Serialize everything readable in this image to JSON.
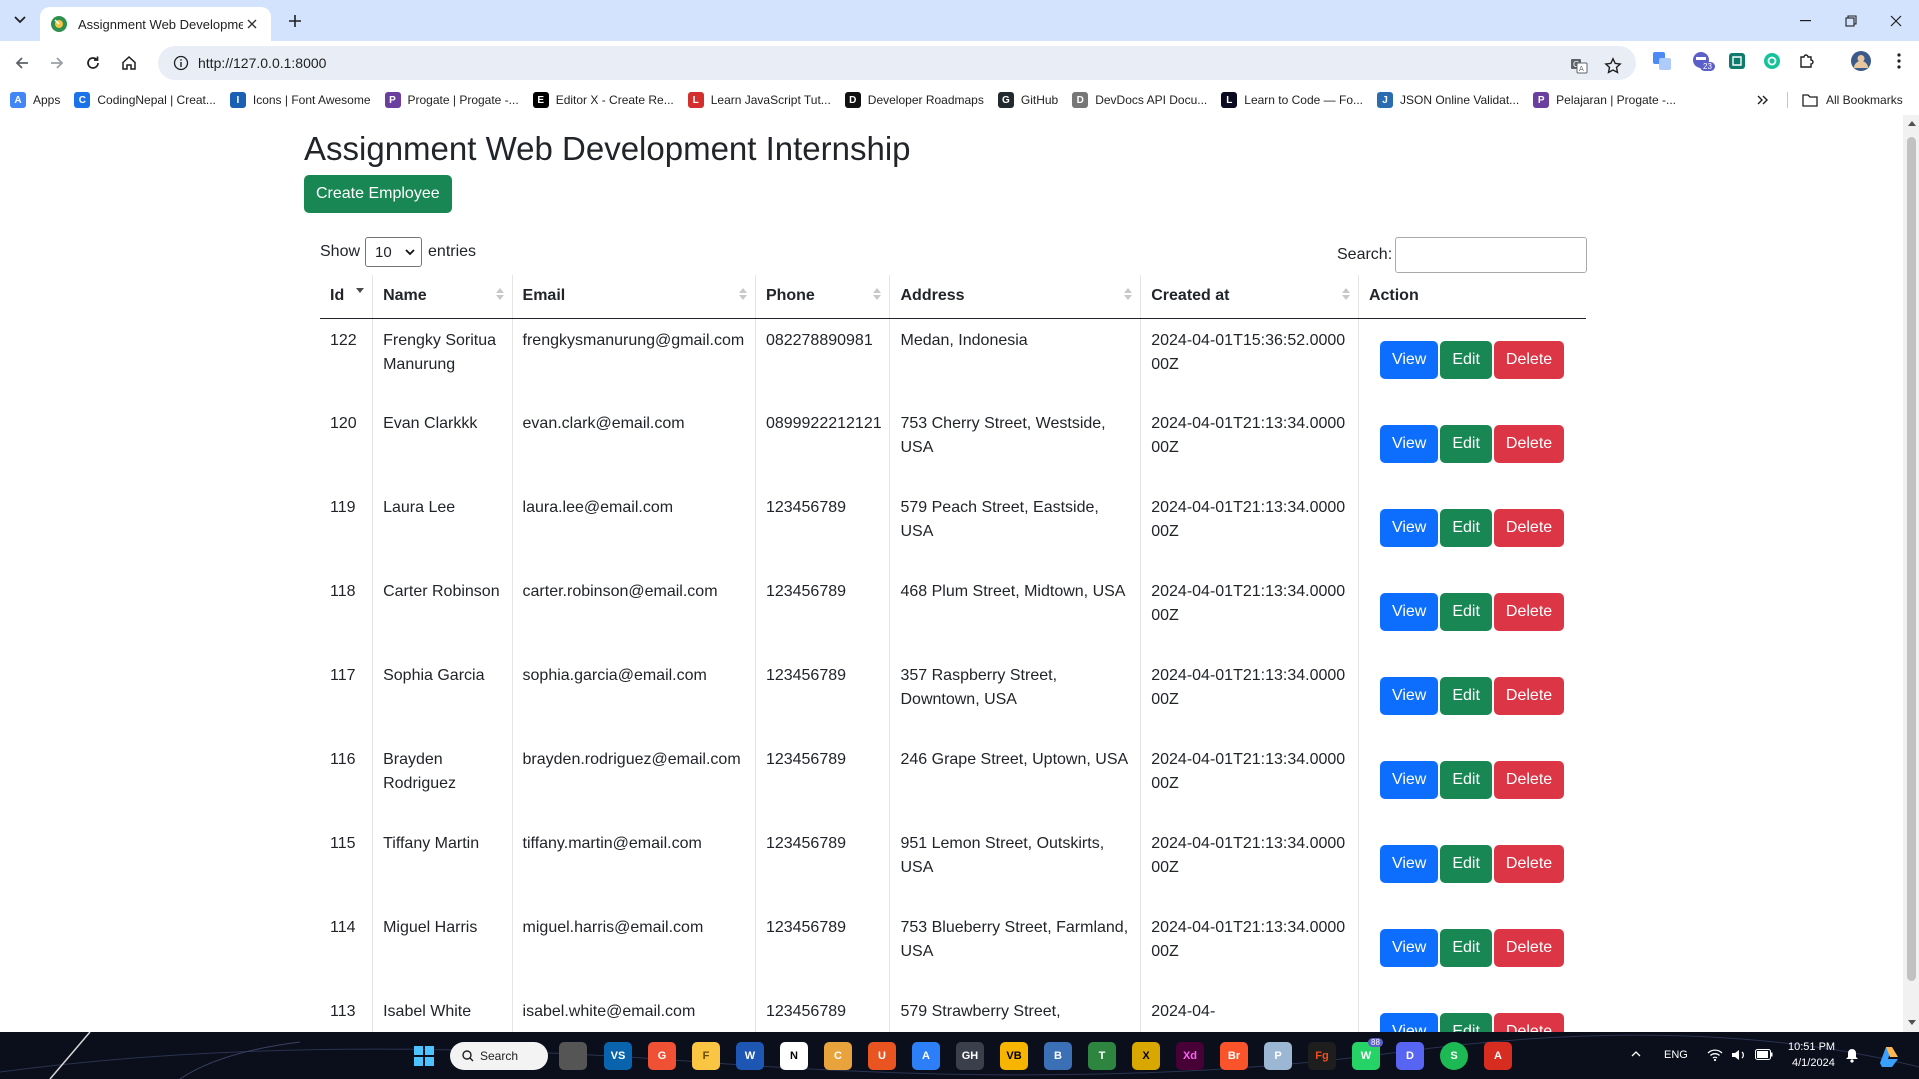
{
  "browser": {
    "tab_title": "Assignment Web Development",
    "url": "http://127.0.0.1:8000",
    "bookmarks": [
      {
        "label": "Apps",
        "icon": "apps-grid-icon",
        "color": "#4285f4"
      },
      {
        "label": "CodingNepal | Creat...",
        "icon": "codingnepal-icon",
        "color": "#1a73e8"
      },
      {
        "label": "Icons | Font Awesome",
        "icon": "font-awesome-flag-icon",
        "color": "#1a5fb4"
      },
      {
        "label": "Progate | Progate -...",
        "icon": "progate-icon",
        "color": "#6b3fa0"
      },
      {
        "label": "Editor X - Create Re...",
        "icon": "editor-x-icon",
        "color": "#000000"
      },
      {
        "label": "Learn JavaScript Tut...",
        "icon": "scrimba-icon",
        "color": "#d32f2f"
      },
      {
        "label": "Developer Roadmaps",
        "icon": "roadmap-icon",
        "color": "#111111"
      },
      {
        "label": "GitHub",
        "icon": "github-icon",
        "color": "#24292f"
      },
      {
        "label": "DevDocs API Docu...",
        "icon": "devdocs-icon",
        "color": "#777777"
      },
      {
        "label": "Learn to Code — Fo...",
        "icon": "freecodecamp-icon",
        "color": "#0a0a23"
      },
      {
        "label": "JSON Online Validat...",
        "icon": "json-icon",
        "color": "#2b6cb0"
      },
      {
        "label": "Pelajaran | Progate -...",
        "icon": "progate-icon",
        "color": "#6b3fa0"
      }
    ],
    "all_bookmarks": "All Bookmarks"
  },
  "page": {
    "title": "Assignment Web Development Internship",
    "create_label": "Create Employee",
    "show_label": "Show",
    "entries_label": "entries",
    "length_value": "10",
    "search_label": "Search:",
    "columns": [
      "Id",
      "Name",
      "Email",
      "Phone",
      "Address",
      "Created at",
      "Action"
    ],
    "action_labels": {
      "view": "View",
      "edit": "Edit",
      "delete": "Delete"
    },
    "rows": [
      {
        "id": "122",
        "name": "Frengky Soritua Manurung",
        "email": "frengkysmanurung@gmail.com",
        "phone": "082278890981",
        "address": "Medan, Indonesia",
        "created": "2024-04-01T15:36:52.000000Z"
      },
      {
        "id": "120",
        "name": "Evan Clarkkk",
        "email": "evan.clark@email.com",
        "phone": "0899922212121",
        "address": "753 Cherry Street, Westside, USA",
        "created": "2024-04-01T21:13:34.000000Z"
      },
      {
        "id": "119",
        "name": "Laura Lee",
        "email": "laura.lee@email.com",
        "phone": "123456789",
        "address": "579 Peach Street, Eastside, USA",
        "created": "2024-04-01T21:13:34.000000Z"
      },
      {
        "id": "118",
        "name": "Carter Robinson",
        "email": "carter.robinson@email.com",
        "phone": "123456789",
        "address": "468 Plum Street, Midtown, USA",
        "created": "2024-04-01T21:13:34.000000Z"
      },
      {
        "id": "117",
        "name": "Sophia Garcia",
        "email": "sophia.garcia@email.com",
        "phone": "123456789",
        "address": "357 Raspberry Street, Downtown, USA",
        "created": "2024-04-01T21:13:34.000000Z"
      },
      {
        "id": "116",
        "name": "Brayden Rodriguez",
        "email": "brayden.rodriguez@email.com",
        "phone": "123456789",
        "address": "246 Grape Street, Uptown, USA",
        "created": "2024-04-01T21:13:34.000000Z"
      },
      {
        "id": "115",
        "name": "Tiffany Martin",
        "email": "tiffany.martin@email.com",
        "phone": "123456789",
        "address": "951 Lemon Street, Outskirts, USA",
        "created": "2024-04-01T21:13:34.000000Z"
      },
      {
        "id": "114",
        "name": "Miguel Harris",
        "email": "miguel.harris@email.com",
        "phone": "123456789",
        "address": "753 Blueberry Street, Farmland, USA",
        "created": "2024-04-01T21:13:34.000000Z"
      },
      {
        "id": "113",
        "name": "Isabel White",
        "email": "isabel.white@email.com",
        "phone": "123456789",
        "address": "579 Strawberry Street,",
        "created": "2024-04-"
      }
    ]
  },
  "taskbar": {
    "search_label": "Search",
    "language": "ENG",
    "time": "10:51 PM",
    "date": "4/1/2024",
    "badge_teams": "23",
    "badge_whatsapp": "88"
  },
  "colors": {
    "primary": "#0d6efd",
    "success": "#198754",
    "danger": "#dc3545",
    "tabstrip": "#d3e3fd"
  }
}
